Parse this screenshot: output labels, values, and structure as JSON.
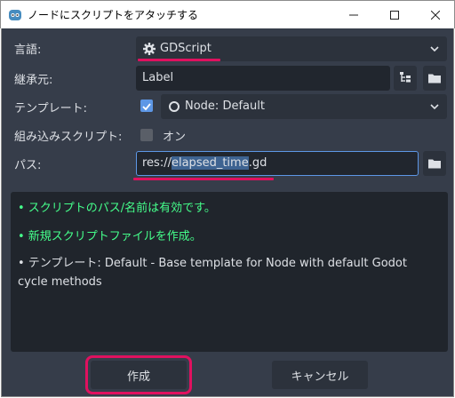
{
  "window": {
    "title": "ノードにスクリプトをアタッチする"
  },
  "form": {
    "language_label": "言語:",
    "language_value": "GDScript",
    "inherits_label": "継承元:",
    "inherits_value": "Label",
    "template_label": "テンプレート:",
    "template_checked": true,
    "template_value": "Node: Default",
    "builtin_label": "組み込みスクリプト:",
    "builtin_checked": false,
    "builtin_option": "オン",
    "path_label": "パス:",
    "path_prefix": "res://",
    "path_selected": "elapsed_time",
    "path_suffix": ".gd"
  },
  "messages": [
    "• スクリプトのパス/名前は有効です。",
    "• 新規スクリプトファイルを作成。",
    "• テンプレート: Default - Base template for Node with default Godot cycle methods"
  ],
  "buttons": {
    "create": "作成",
    "cancel": "キャンセル"
  },
  "colors": {
    "accent": "#5d97e6",
    "highlight": "#e0115f",
    "valid_text": "#45ff8b",
    "panel_bg": "#363d4a"
  },
  "icons": [
    "godot-icon",
    "minimize-icon",
    "maximize-icon",
    "close-icon",
    "gear-icon",
    "chevron-down-icon",
    "tree-icon",
    "folder-icon",
    "checkbox-icon",
    "circle-icon"
  ]
}
